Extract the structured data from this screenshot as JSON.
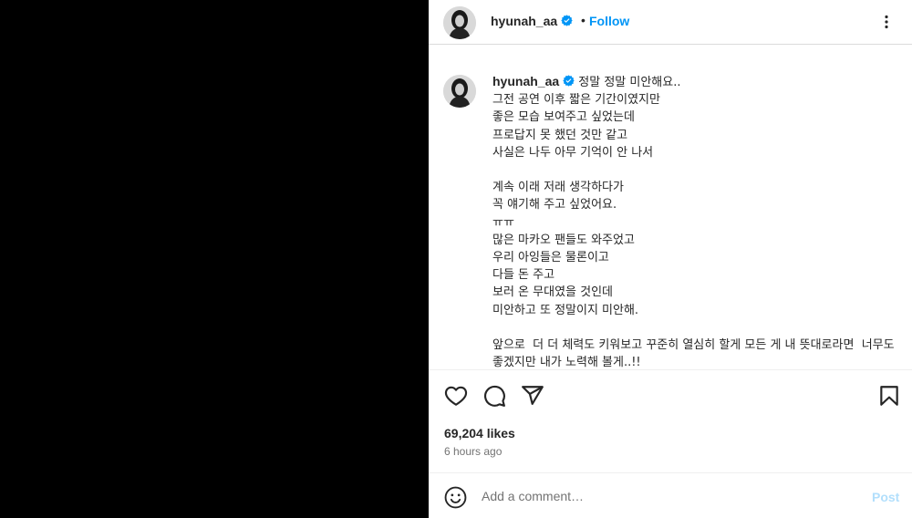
{
  "colors": {
    "media_bg": "#000000",
    "accent": "#0095f6",
    "post_disabled": "#b2dffc",
    "muted_text": "#737373"
  },
  "header": {
    "username": "hyunah_aa",
    "dot": "•",
    "follow_label": "Follow",
    "verified_icon": "verified-badge-icon",
    "more_icon": "more-options-icon"
  },
  "caption": {
    "username": "hyunah_aa",
    "text": "정말 정말 미안해요..\n그전 공연 이후 짧은 기간이였지만\n좋은 모습 보여주고 싶었는데\n프로답지 못 했던 것만 같고\n사실은 나두 아무 기억이 안 나서\n\n계속 이래 저래 생각하다가\n꼭 얘기해 주고 싶었어요.\nㅠㅠ\n많은 마카오 팬들도 와주었고\n우리 아잉들은 물론이고\n다들 돈 주고\n보러 온 무대였을 것인데\n미안하고 또 정말이지 미안해.\n\n앞으로  더 더 체력도 키워보고 꾸준히 열심히 할게 모든 게 내 뜻대로라면  너무도 좋겠지만 내가 노력해 볼게..!!"
  },
  "actions": {
    "like_icon": "heart-icon",
    "comment_icon": "comment-icon",
    "share_icon": "share-icon",
    "save_icon": "bookmark-icon"
  },
  "likes": "69,204 likes",
  "timestamp": "6 hours ago",
  "comment": {
    "placeholder": "Add a comment…",
    "post_label": "Post",
    "emoji_icon": "emoji-icon"
  }
}
